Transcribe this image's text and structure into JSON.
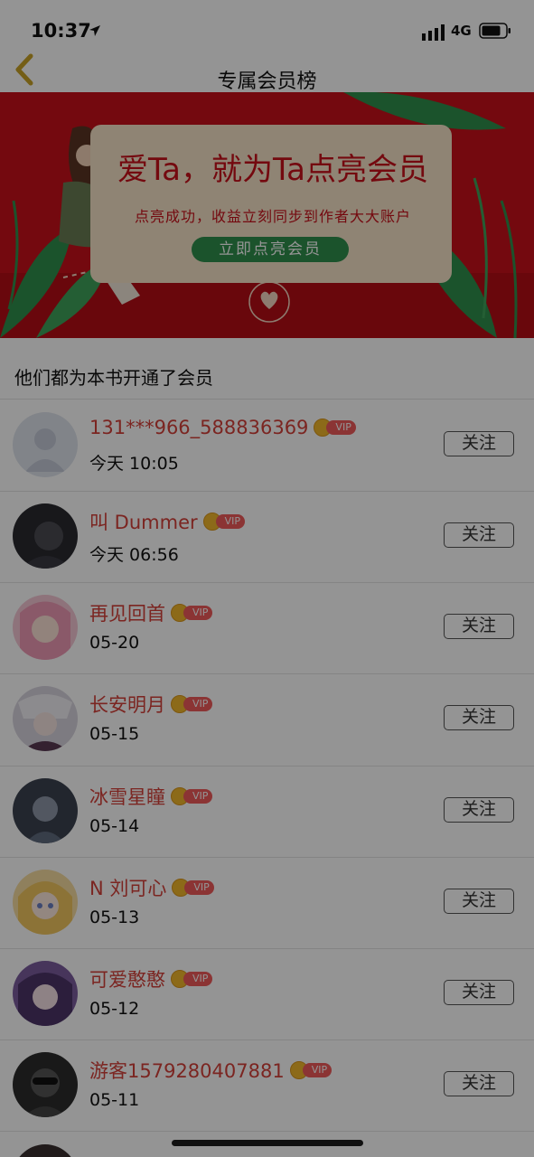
{
  "status_bar": {
    "time": "10:37",
    "network": "4G"
  },
  "nav": {
    "title": "专属会员榜"
  },
  "banner": {
    "headline": "爱Ta，就为Ta点亮会员",
    "subtitle": "点亮成功，收益立刻同步到作者大大账户",
    "button_label": "立即点亮会员"
  },
  "section": {
    "title": "他们都为本书开通了会员"
  },
  "vip_label": "VIP",
  "follow_label": "关注",
  "members": [
    {
      "name": "131***966_588836369",
      "date": "今天 10:05",
      "avatar": "default-avatar",
      "color": "#dfe3ec"
    },
    {
      "name": "叫 Dummer",
      "date": "今天 06:56",
      "avatar": "dark-photo",
      "color": "#2a2a30"
    },
    {
      "name": "再见回首",
      "date": "05-20",
      "avatar": "anime-pink",
      "color": "#f4c7d4"
    },
    {
      "name": "长安明月",
      "date": "05-15",
      "avatar": "anime-white",
      "color": "#d8d4de"
    },
    {
      "name": "冰雪星瞳",
      "date": "05-14",
      "avatar": "anime-dark",
      "color": "#3b4250"
    },
    {
      "name": "N 刘可心",
      "date": "05-13",
      "avatar": "anime-blonde",
      "color": "#f6dca0"
    },
    {
      "name": "可爱憨憨",
      "date": "05-12",
      "avatar": "anime-purple",
      "color": "#7a5c9e"
    },
    {
      "name": "游客1579280407881",
      "date": "05-11",
      "avatar": "mask-dark",
      "color": "#2b2b2b"
    }
  ]
}
